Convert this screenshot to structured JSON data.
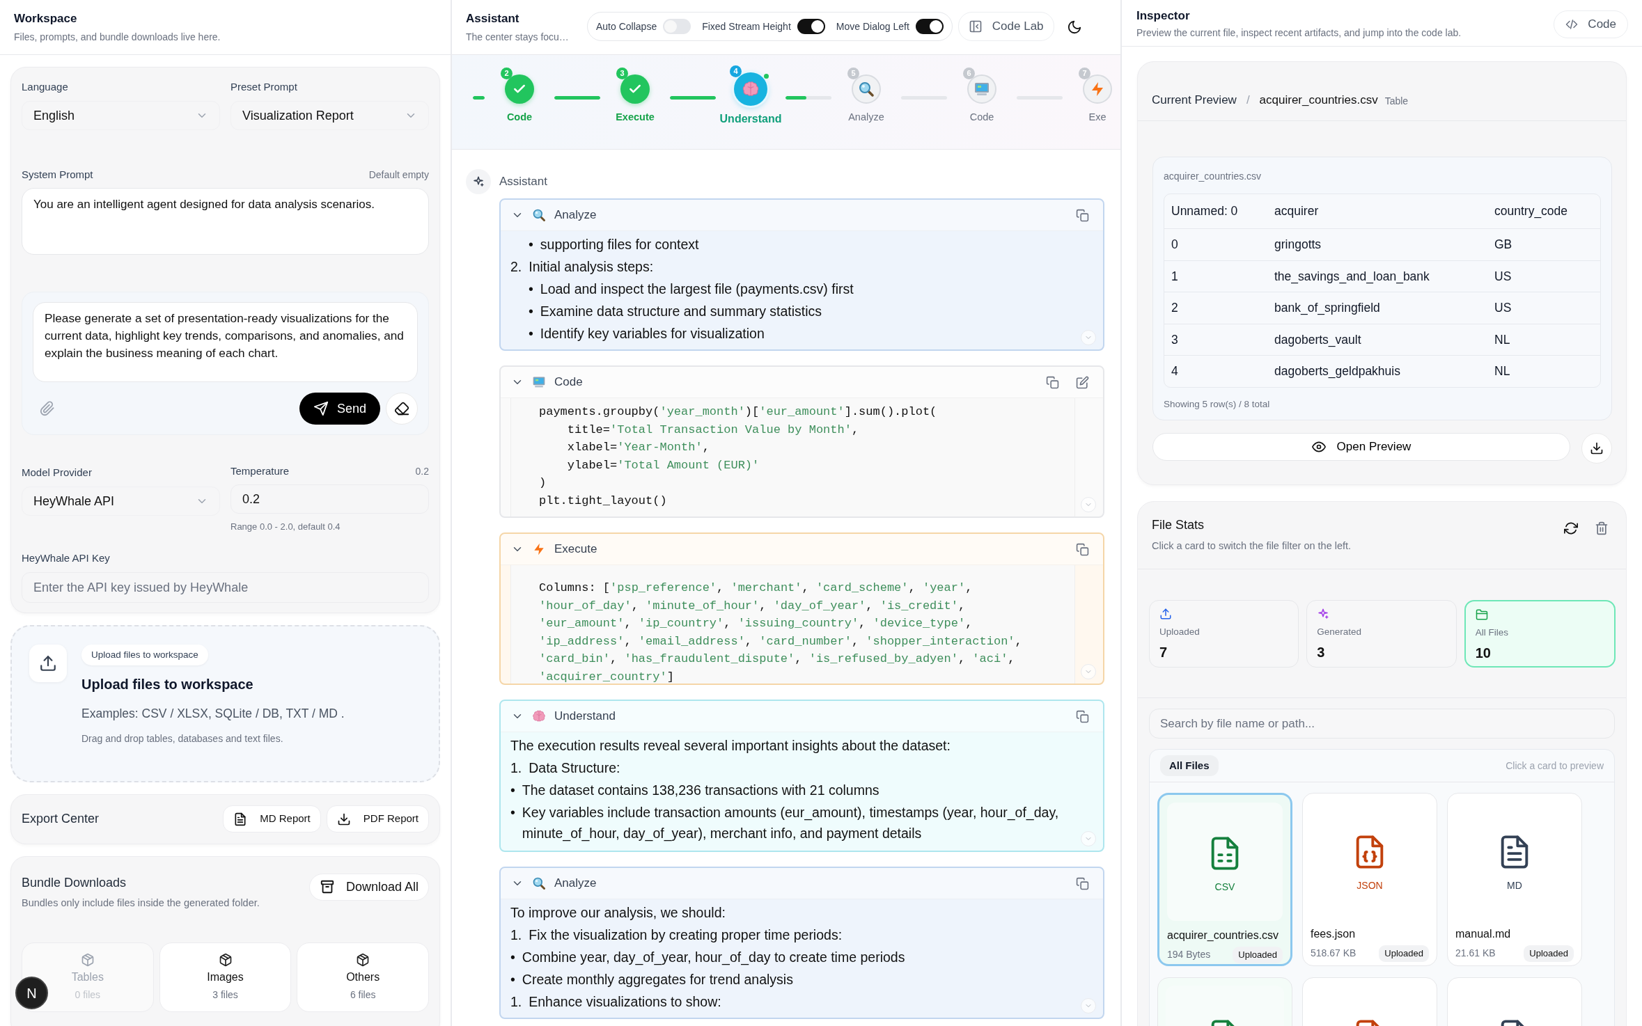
{
  "workspace": {
    "title": "Workspace",
    "subtitle": "Files, prompts, and bundle downloads live here.",
    "language": {
      "label": "Language",
      "value": "English"
    },
    "preset": {
      "label": "Preset Prompt",
      "value": "Visualization Report"
    },
    "system_prompt": {
      "label": "System Prompt",
      "hint": "Default empty",
      "value": "You are an intelligent agent designed for data analysis scenarios."
    },
    "composer": {
      "value": "Please generate a set of presentation-ready visualizations for the current data, highlight key trends, comparisons, and anomalies, and explain the business meaning of each chart.",
      "send": "Send"
    },
    "model_provider": {
      "label": "Model Provider",
      "value": "HeyWhale API"
    },
    "temperature": {
      "label": "Temperature",
      "reading": "0.2",
      "value": "0.2",
      "hint": "Range 0.0 - 2.0, default 0.4"
    },
    "api_key": {
      "label": "HeyWhale API Key",
      "placeholder": "Enter the API key issued by HeyWhale"
    },
    "upload": {
      "chip": "Upload files to workspace",
      "title": "Upload files to workspace",
      "examples": "Examples: CSV / XLSX, SQLite / DB, TXT / MD .",
      "hint": "Drag and drop tables, databases and text files."
    },
    "export": {
      "title": "Export Center",
      "buttons": [
        {
          "kind": "md",
          "label": "MD Report"
        },
        {
          "kind": "pdf",
          "label": "PDF Report"
        }
      ]
    },
    "bundles": {
      "title": "Bundle Downloads",
      "subtitle": "Bundles only include files inside the generated folder.",
      "button": "Download All",
      "items": [
        {
          "label": "Tables",
          "count": "0 files",
          "disabled": true
        },
        {
          "label": "Images",
          "count": "3 files",
          "disabled": false
        },
        {
          "label": "Others",
          "count": "6 files",
          "disabled": false
        }
      ]
    },
    "user": {
      "initial": "N"
    }
  },
  "assistant": {
    "title": "Assistant",
    "subtitle": "The center stays focu…",
    "toggles": [
      {
        "label": "Auto Collapse",
        "on": false
      },
      {
        "label": "Fixed Stream Height",
        "on": true
      },
      {
        "label": "Move Dialog Left",
        "on": true
      }
    ],
    "code_lab": "Code Lab",
    "steps": [
      {
        "number": "2",
        "label": "Code",
        "done": true,
        "active": false
      },
      {
        "number": "3",
        "label": "Execute",
        "done": true,
        "active": false
      },
      {
        "number": "4",
        "label": "Understand",
        "kind": "understand",
        "done": false,
        "active": true
      },
      {
        "number": "5",
        "label": "Analyze",
        "kind": "analyze",
        "done": false,
        "active": false
      },
      {
        "number": "6",
        "label": "Code",
        "kind": "code",
        "done": false,
        "active": false
      },
      {
        "number": "7",
        "label": "Exe",
        "kind": "execute",
        "done": false,
        "active": false
      }
    ],
    "connectors": [
      {
        "level": 1
      },
      {
        "level": 1
      },
      {
        "level": 1
      },
      {
        "level": 0.45
      }
    ],
    "speaker": "Assistant",
    "blocks": [
      {
        "kind": "analyze",
        "title": "Analyze",
        "items": [
          {
            "children": [
              {
                "marker": "•",
                "text": "supporting files for context"
              }
            ]
          },
          {
            "marker": "2.",
            "text": "Initial analysis steps:",
            "children": [
              {
                "marker": "•",
                "text": "Load and inspect the largest file (payments.csv) first"
              },
              {
                "marker": "•",
                "text": "Examine data structure and summary statistics"
              },
              {
                "marker": "•",
                "text": "Identify key variables for visualization"
              }
            ]
          }
        ]
      },
      {
        "kind": "code",
        "title": "Code",
        "lines": [
          "payments.groupby('year_month')['eur_amount'].sum().plot(",
          "    title='Total Transaction Value by Month',",
          "    xlabel='Year-Month',",
          "    ylabel='Total Amount (EUR)'",
          ")",
          "plt.tight_layout()"
        ]
      },
      {
        "kind": "execute",
        "title": "Execute",
        "lines": [
          "Columns: ['psp_reference', 'merchant', 'card_scheme', 'year',",
          "'hour_of_day', 'minute_of_hour', 'day_of_year', 'is_credit',",
          "'eur_amount', 'ip_country', 'issuing_country', 'device_type',",
          "'ip_address', 'email_address', 'card_number', 'shopper_interaction',",
          "'card_bin', 'has_fraudulent_dispute', 'is_refused_by_adyen', 'aci',",
          "'acquirer_country']"
        ]
      },
      {
        "kind": "understand",
        "title": "Understand",
        "items": [
          {
            "text": "The execution results reveal several important insights about the dataset:"
          },
          {
            "marker": "1.",
            "text": "Data Structure:"
          },
          {
            "marker": "•",
            "text": "The dataset contains 138,236 transactions with 21 columns"
          },
          {
            "marker": "•",
            "text": "Key variables include transaction amounts (eur_amount), timestamps (year, hour_of_day, minute_of_hour, day_of_year), merchant info, and payment details"
          }
        ]
      },
      {
        "kind": "analyze",
        "title": "Analyze",
        "items": [
          {
            "text": "To improve our analysis, we should:"
          },
          {
            "marker": "1.",
            "text": "Fix the visualization by creating proper time periods:"
          },
          {
            "marker": "•",
            "text": "Combine year, day_of_year, hour_of_day to create time periods"
          },
          {
            "marker": "•",
            "text": "Create monthly aggregates for trend analysis"
          },
          {
            "marker": "1.",
            "text": "Enhance visualizations to show:"
          }
        ]
      }
    ]
  },
  "inspector": {
    "title": "Inspector",
    "subtitle": "Preview the current file, inspect recent artifacts, and jump into the code lab.",
    "code_button": "Code",
    "preview": {
      "crumb": "Current Preview",
      "separator": "/",
      "file": "acquirer_countries.csv",
      "type": "Table",
      "table_caption": "acquirer_countries.csv",
      "table": {
        "columns": [
          "Unnamed: 0",
          "acquirer",
          "country_code"
        ],
        "rows": [
          [
            "0",
            "gringotts",
            "GB"
          ],
          [
            "1",
            "the_savings_and_loan_bank",
            "US"
          ],
          [
            "2",
            "bank_of_springfield",
            "US"
          ],
          [
            "3",
            "dagoberts_vault",
            "NL"
          ],
          [
            "4",
            "dagoberts_geldpakhuis",
            "NL"
          ]
        ]
      },
      "footer": "Showing 5 row(s) / 8 total",
      "open_button": "Open Preview"
    },
    "stats": {
      "title": "File Stats",
      "subtitle": "Click a card to switch the file filter on the left.",
      "cards": [
        {
          "kind": "uploaded",
          "label": "Uploaded",
          "count": "7",
          "selected": false
        },
        {
          "kind": "generated",
          "label": "Generated",
          "count": "3",
          "selected": false
        },
        {
          "kind": "all",
          "label": "All Files",
          "count": "10",
          "selected": true
        }
      ],
      "search": {
        "placeholder": "Search by file name or path..."
      },
      "filter": "All Files",
      "filter_hint": "Click a card to preview",
      "files": [
        {
          "kind": "csv",
          "type_label": "CSV",
          "name": "acquirer_countries.csv",
          "size": "194 Bytes",
          "tag": "Uploaded",
          "selected": true
        },
        {
          "kind": "json",
          "type_label": "JSON",
          "name": "fees.json",
          "size": "518.67 KB",
          "tag": "Uploaded",
          "selected": false
        },
        {
          "kind": "md",
          "type_label": "MD",
          "name": "manual.md",
          "size": "21.61 KB",
          "tag": "Uploaded",
          "selected": false
        },
        {
          "kind": "csv",
          "selected": false
        },
        {
          "kind": "json",
          "selected": false
        },
        {
          "kind": "md",
          "selected": false
        }
      ]
    }
  }
}
